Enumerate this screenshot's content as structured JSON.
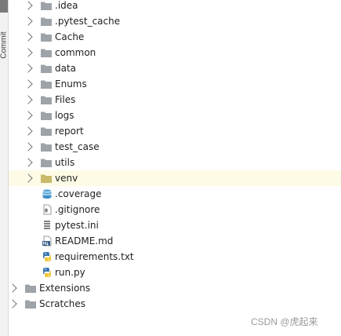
{
  "side_strip": {
    "label": "Commit"
  },
  "tree": {
    "folders": [
      {
        "label": ".idea"
      },
      {
        "label": ".pytest_cache"
      },
      {
        "label": "Cache"
      },
      {
        "label": "common"
      },
      {
        "label": "data"
      },
      {
        "label": "Enums"
      },
      {
        "label": "Files"
      },
      {
        "label": "logs"
      },
      {
        "label": "report"
      },
      {
        "label": "test_case"
      },
      {
        "label": "utils"
      },
      {
        "label": "venv",
        "highlighted": true
      }
    ],
    "files": [
      {
        "label": ".coverage",
        "icon": "coverage-file-icon"
      },
      {
        "label": ".gitignore",
        "icon": "gitignore-file-icon"
      },
      {
        "label": "pytest.ini",
        "icon": "ini-file-icon"
      },
      {
        "label": "README.md",
        "icon": "markdown-file-icon"
      },
      {
        "label": "requirements.txt",
        "icon": "python-file-icon"
      },
      {
        "label": "run.py",
        "icon": "python-file-icon"
      }
    ],
    "root_items": [
      {
        "label": "Extensions"
      },
      {
        "label": "Scratches"
      }
    ]
  },
  "watermark": "CSDN @虎起来",
  "colors": {
    "folder": "#9da3a8",
    "highlight_row": "#fdfbe6",
    "python_blue": "#3c78b4",
    "python_yellow": "#f0c83c"
  }
}
